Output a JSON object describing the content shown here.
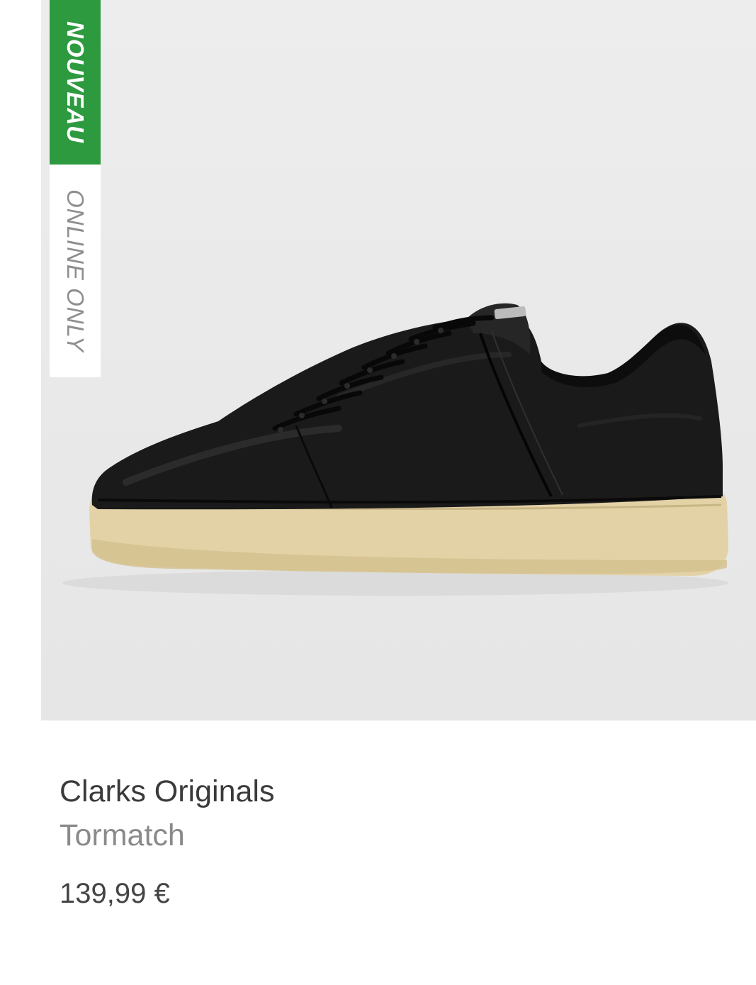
{
  "badges": {
    "new": "NOUVEAU",
    "online_only": "ONLINE ONLY"
  },
  "product": {
    "brand": "Clarks Originals",
    "model": "Tormatch",
    "price": "139,99 €",
    "image_icon": "sneaker-image"
  },
  "colors": {
    "new_badge": "#2e9a3f",
    "brand_text": "#3a3a3a",
    "model_text": "#8a8a8a",
    "price_text": "#444444"
  }
}
